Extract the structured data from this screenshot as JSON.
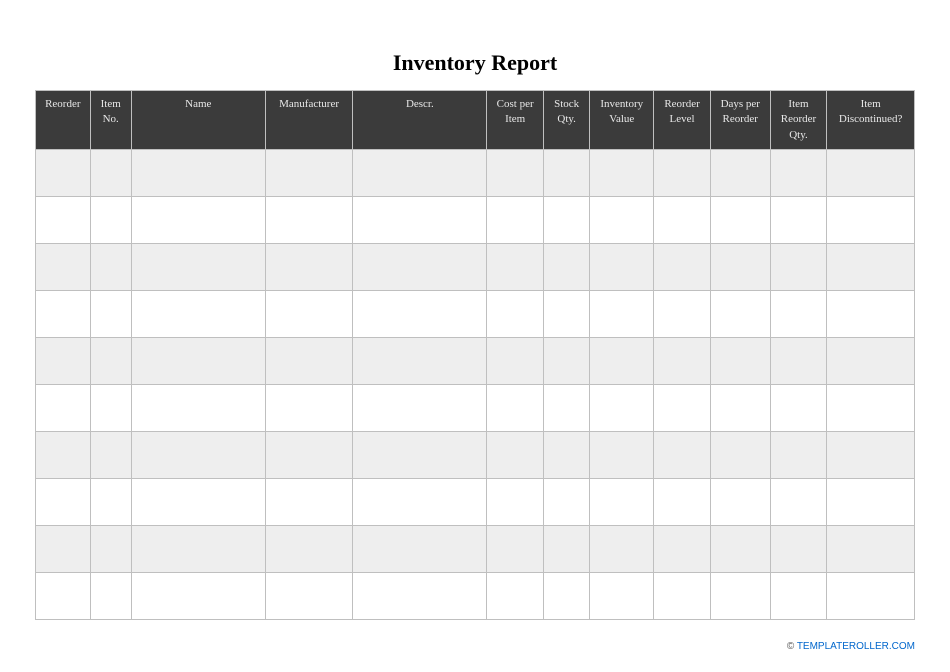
{
  "title": "Inventory Report",
  "columns": [
    {
      "key": "reorder",
      "label": "Reorder"
    },
    {
      "key": "itemno",
      "label": "Item No."
    },
    {
      "key": "name",
      "label": "Name"
    },
    {
      "key": "manufacturer",
      "label": "Manufacturer"
    },
    {
      "key": "descr",
      "label": "Descr."
    },
    {
      "key": "costper",
      "label": "Cost per Item"
    },
    {
      "key": "stockqty",
      "label": "Stock Qty."
    },
    {
      "key": "invvalue",
      "label": "Inventory Value"
    },
    {
      "key": "reorderlevel",
      "label": "Reorder Level"
    },
    {
      "key": "daysper",
      "label": "Days per Reorder"
    },
    {
      "key": "itemreorderqty",
      "label": "Item Reorder Qty."
    },
    {
      "key": "discontinued",
      "label": "Item Discontinued?"
    }
  ],
  "rows": [
    {
      "reorder": "",
      "itemno": "",
      "name": "",
      "manufacturer": "",
      "descr": "",
      "costper": "",
      "stockqty": "",
      "invvalue": "",
      "reorderlevel": "",
      "daysper": "",
      "itemreorderqty": "",
      "discontinued": ""
    },
    {
      "reorder": "",
      "itemno": "",
      "name": "",
      "manufacturer": "",
      "descr": "",
      "costper": "",
      "stockqty": "",
      "invvalue": "",
      "reorderlevel": "",
      "daysper": "",
      "itemreorderqty": "",
      "discontinued": ""
    },
    {
      "reorder": "",
      "itemno": "",
      "name": "",
      "manufacturer": "",
      "descr": "",
      "costper": "",
      "stockqty": "",
      "invvalue": "",
      "reorderlevel": "",
      "daysper": "",
      "itemreorderqty": "",
      "discontinued": ""
    },
    {
      "reorder": "",
      "itemno": "",
      "name": "",
      "manufacturer": "",
      "descr": "",
      "costper": "",
      "stockqty": "",
      "invvalue": "",
      "reorderlevel": "",
      "daysper": "",
      "itemreorderqty": "",
      "discontinued": ""
    },
    {
      "reorder": "",
      "itemno": "",
      "name": "",
      "manufacturer": "",
      "descr": "",
      "costper": "",
      "stockqty": "",
      "invvalue": "",
      "reorderlevel": "",
      "daysper": "",
      "itemreorderqty": "",
      "discontinued": ""
    },
    {
      "reorder": "",
      "itemno": "",
      "name": "",
      "manufacturer": "",
      "descr": "",
      "costper": "",
      "stockqty": "",
      "invvalue": "",
      "reorderlevel": "",
      "daysper": "",
      "itemreorderqty": "",
      "discontinued": ""
    },
    {
      "reorder": "",
      "itemno": "",
      "name": "",
      "manufacturer": "",
      "descr": "",
      "costper": "",
      "stockqty": "",
      "invvalue": "",
      "reorderlevel": "",
      "daysper": "",
      "itemreorderqty": "",
      "discontinued": ""
    },
    {
      "reorder": "",
      "itemno": "",
      "name": "",
      "manufacturer": "",
      "descr": "",
      "costper": "",
      "stockqty": "",
      "invvalue": "",
      "reorderlevel": "",
      "daysper": "",
      "itemreorderqty": "",
      "discontinued": ""
    },
    {
      "reorder": "",
      "itemno": "",
      "name": "",
      "manufacturer": "",
      "descr": "",
      "costper": "",
      "stockqty": "",
      "invvalue": "",
      "reorderlevel": "",
      "daysper": "",
      "itemreorderqty": "",
      "discontinued": ""
    },
    {
      "reorder": "",
      "itemno": "",
      "name": "",
      "manufacturer": "",
      "descr": "",
      "costper": "",
      "stockqty": "",
      "invvalue": "",
      "reorderlevel": "",
      "daysper": "",
      "itemreorderqty": "",
      "discontinued": ""
    }
  ],
  "footer": {
    "copyright": "© ",
    "link_text": "TEMPLATEROLLER.COM"
  }
}
